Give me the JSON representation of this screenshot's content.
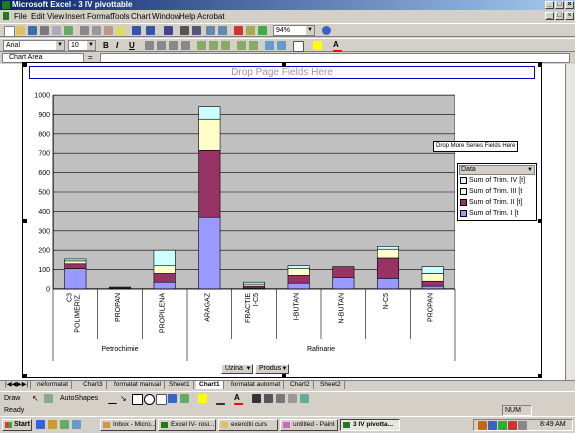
{
  "window": {
    "title": "Microsoft Excel - 3 IV pivottable"
  },
  "menu": {
    "items": [
      "File",
      "Edit",
      "View",
      "Insert",
      "Format",
      "Tools",
      "Chart",
      "Window",
      "Help",
      "Acrobat"
    ]
  },
  "toolbar": {
    "zoom": "94%",
    "font": "Arial",
    "size": "10"
  },
  "namebox": {
    "value": "Chart Area",
    "fx": "="
  },
  "pivot": {
    "drop_page": "Drop Page Fields Here",
    "drop_series": "Drop More Series Fields Here",
    "legend_header": "Data",
    "legend_items": [
      "Sum of Trim. IV",
      "Sum of Trim. III",
      "Sum of Trim. II",
      "Sum of Trim. I"
    ],
    "legend_suffixes": [
      "[t]",
      "[t",
      "[t]",
      "[t"
    ],
    "buttons": [
      "Uzina",
      "Produs"
    ]
  },
  "chart_data": {
    "type": "bar",
    "stacked": true,
    "categories": [
      "C3 POLIMERIZ.",
      "PROPAN",
      "PROPILENA",
      "ARAGAZ",
      "FRACTIE I-C5",
      "I-BUTAN",
      "N-BUTAN",
      "N-C5",
      "PROPAN"
    ],
    "category_groups": [
      {
        "name": "Petrochimie",
        "count": 3
      },
      {
        "name": "Rafinarie",
        "count": 6
      }
    ],
    "series": [
      {
        "name": "Sum of Trim. I",
        "color": "#9999ff",
        "values": [
          105,
          5,
          35,
          370,
          5,
          30,
          60,
          55,
          15
        ]
      },
      {
        "name": "Sum of Trim. II",
        "color": "#993366",
        "values": [
          25,
          5,
          45,
          345,
          10,
          40,
          55,
          105,
          25
        ]
      },
      {
        "name": "Sum of Trim. III",
        "color": "#ffffcc",
        "values": [
          15,
          0,
          40,
          160,
          10,
          35,
          0,
          45,
          40
        ]
      },
      {
        "name": "Sum of Trim. IV",
        "color": "#ccffff",
        "values": [
          10,
          0,
          80,
          65,
          10,
          15,
          0,
          15,
          35
        ]
      }
    ],
    "yticks": [
      "0",
      "100",
      "200",
      "300",
      "400",
      "500",
      "600",
      "700",
      "800",
      "900",
      "1000"
    ],
    "ylim": [
      0,
      1000
    ],
    "grid": true,
    "legend": "right"
  },
  "sheet_tabs": [
    "neformatat",
    "Chart3",
    "formatat manual",
    "Sheet1",
    "Chart1",
    "formatat automat",
    "Chart2",
    "Sheet2"
  ],
  "active_tab": "Chart1",
  "draw_toolbar": {
    "draw": "Draw",
    "autoshapes": "AutoShapes"
  },
  "status": {
    "left": "Ready",
    "num": "NUM"
  },
  "taskbar": {
    "start": "Start",
    "tasks": [
      "Inbox - Micro...",
      "Excel IV- rosi...",
      "exercitii curs",
      "untitled - Paint",
      "3 IV pivotta..."
    ],
    "time": "8:49 AM"
  }
}
